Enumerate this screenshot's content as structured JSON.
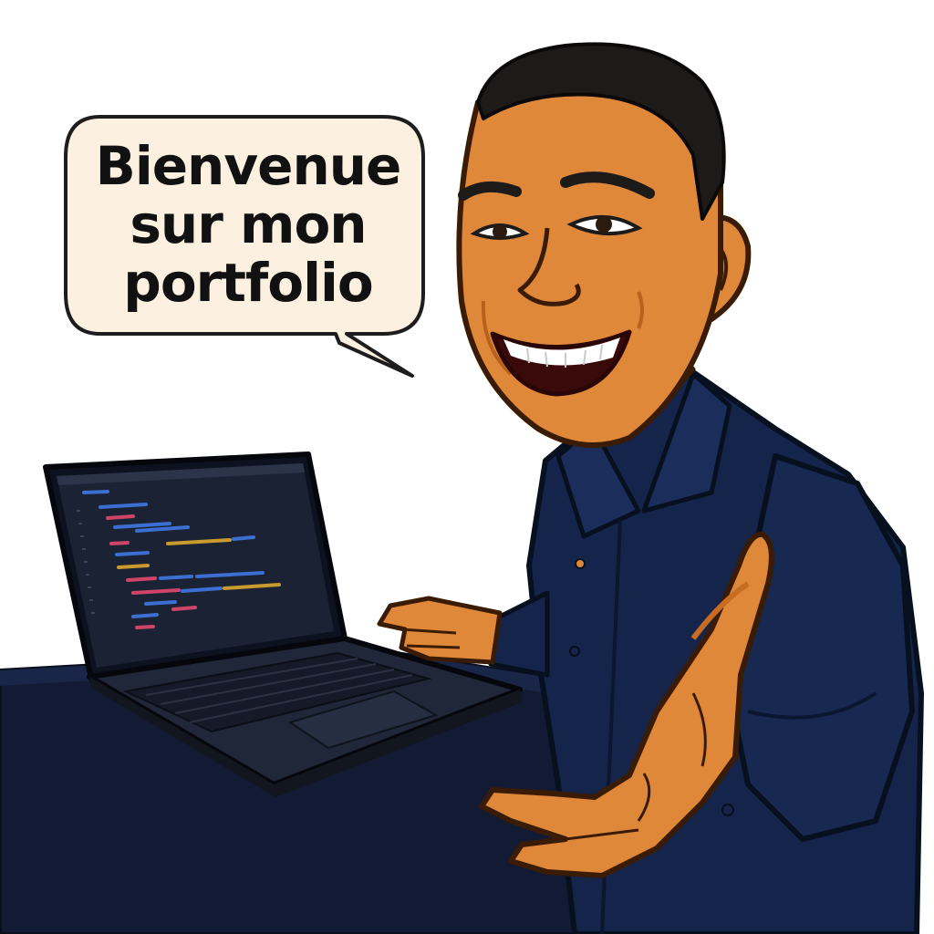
{
  "speech_bubble": {
    "lines": [
      "Bienvenue",
      "sur mon",
      "portfolio"
    ]
  },
  "colors": {
    "bubble_fill": "#fcf1e0",
    "skin": "#e0883a",
    "shirt": "#15244a",
    "desk": "#121b33",
    "laptop": "#1c2436",
    "hair": "#1d1a1a"
  },
  "icons": {
    "avatar": "smiling-man-illustration",
    "laptop": "laptop-with-code-illustration"
  }
}
